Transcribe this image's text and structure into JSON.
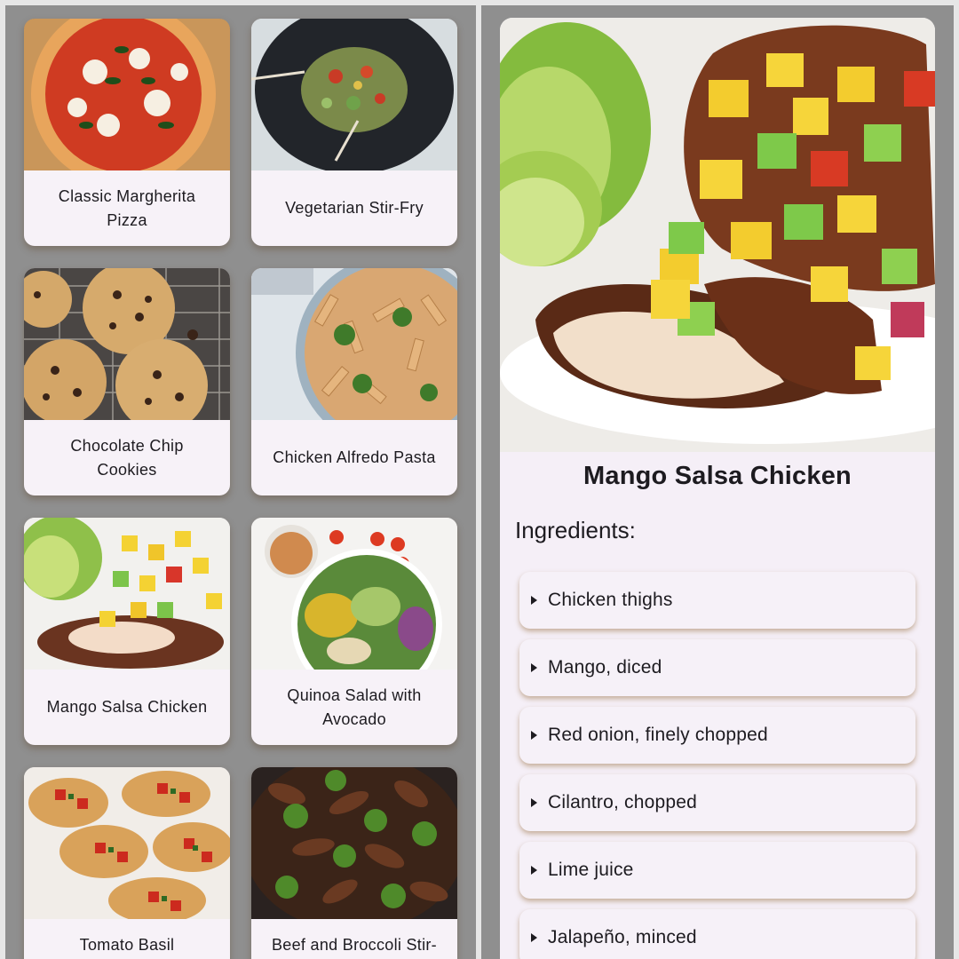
{
  "recipes": [
    {
      "name": "Classic Margherita Pizza",
      "line1": "Classic Margherita",
      "line2": "Pizza"
    },
    {
      "name": "Vegetarian Stir-Fry",
      "line1": "Vegetarian Stir-Fry",
      "line2": ""
    },
    {
      "name": "Chocolate Chip Cookies",
      "line1": "Chocolate Chip",
      "line2": "Cookies"
    },
    {
      "name": "Chicken Alfredo Pasta",
      "line1": "Chicken Alfredo Pasta",
      "line2": ""
    },
    {
      "name": "Mango Salsa Chicken",
      "line1": "Mango Salsa Chicken",
      "line2": ""
    },
    {
      "name": "Quinoa Salad with Avocado",
      "line1": "Quinoa Salad with",
      "line2": "Avocado"
    },
    {
      "name": "Tomato Basil",
      "line1": "Tomato Basil",
      "line2": ""
    },
    {
      "name": "Beef and Broccoli Stir-",
      "line1": "Beef and Broccoli Stir-",
      "line2": ""
    }
  ],
  "detail": {
    "title": "Mango Salsa Chicken",
    "ingredients_heading": "Ingredients:",
    "ingredients": [
      "Chicken thighs",
      "Mango, diced",
      "Red onion, finely chopped",
      "Cilantro, chopped",
      "Lime juice",
      "Jalapeño, minced"
    ]
  },
  "icons": {
    "expand": "arrow-right-icon"
  },
  "colors": {
    "card_background": "#f7f2f8",
    "screen_background": "#8f8f8f",
    "text": "#1d1b20"
  }
}
